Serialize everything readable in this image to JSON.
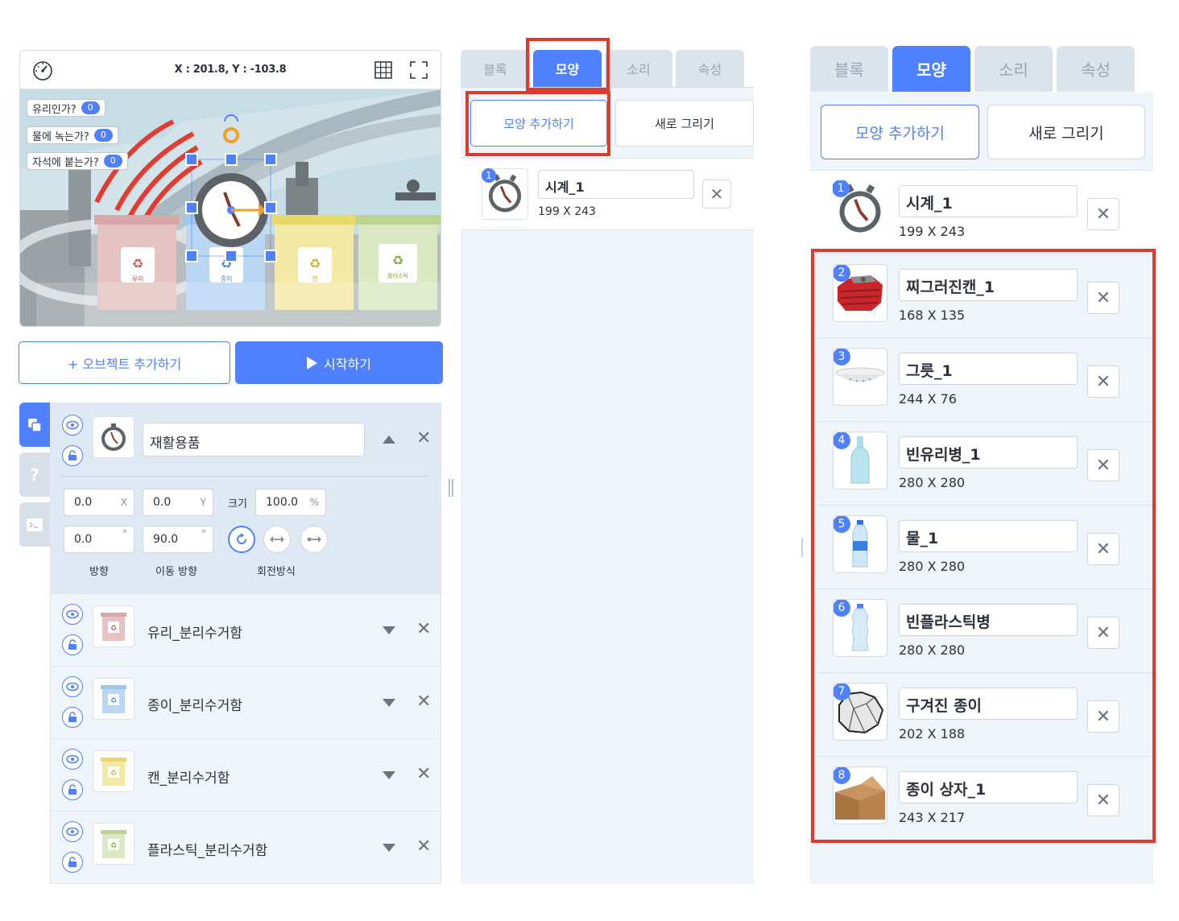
{
  "stage": {
    "coords": "X : 201.8, Y : -103.8",
    "variables": [
      {
        "label": "유리인가?",
        "value": "0"
      },
      {
        "label": "물에 녹는가?",
        "value": "0"
      },
      {
        "label": "자석에 붙는가?",
        "value": "0"
      }
    ],
    "bins": [
      "유리",
      "종이",
      "캔",
      "플라스틱"
    ]
  },
  "buttons": {
    "add_object": "+ 오브젝트 추가하기",
    "start": "시작하기"
  },
  "side_tabs": {
    "help": "?"
  },
  "selected_object": {
    "name": "재활용품",
    "x": "0.0",
    "x_unit": "X",
    "y": "0.0",
    "y_unit": "Y",
    "size_label": "크기",
    "size": "100.0",
    "size_unit": "%",
    "direction": "0.0",
    "direction_unit": "°",
    "move_direction": "90.0",
    "move_direction_unit": "°",
    "label_direction": "방향",
    "label_move_direction": "이동 방향",
    "label_rotation": "회전방식"
  },
  "objects": [
    {
      "name": "유리_분리수거함",
      "color": "#e8a7a7"
    },
    {
      "name": "종이_분리수거함",
      "color": "#9ec6ee"
    },
    {
      "name": "캔_분리수거함",
      "color": "#f1e28b"
    },
    {
      "name": "플라스틱_분리수거함",
      "color": "#c9dfa2"
    }
  ],
  "middle": {
    "tabs": [
      "블록",
      "모양",
      "소리",
      "속성"
    ],
    "add_shape": "모양 추가하기",
    "new_draw": "새로 그리기",
    "shape": {
      "num": "1",
      "name": "시계_1",
      "size": "199 X 243"
    }
  },
  "right": {
    "tabs": [
      "블록",
      "모양",
      "소리",
      "속성"
    ],
    "add_shape": "모양 추가하기",
    "new_draw": "새로 그리기",
    "shapes": [
      {
        "num": "1",
        "name": "시계_1",
        "size": "199 X 243",
        "icon": "clock-icon"
      },
      {
        "num": "2",
        "name": "찌그러진캔_1",
        "size": "168 X 135",
        "icon": "crushed-can-icon"
      },
      {
        "num": "3",
        "name": "그릇_1",
        "size": "244 X 76",
        "icon": "bowl-icon"
      },
      {
        "num": "4",
        "name": "빈유리병_1",
        "size": "280 X 280",
        "icon": "glass-bottle-icon"
      },
      {
        "num": "5",
        "name": "물_1",
        "size": "280 X 280",
        "icon": "water-bottle-icon"
      },
      {
        "num": "6",
        "name": "빈플라스틱병",
        "size": "280 X 280",
        "icon": "plastic-bottle-icon"
      },
      {
        "num": "7",
        "name": "구겨진 종이",
        "size": "202 X 188",
        "icon": "crumpled-paper-icon"
      },
      {
        "num": "8",
        "name": "종이 상자_1",
        "size": "243 X 217",
        "icon": "paper-box-icon"
      }
    ]
  },
  "colors": {
    "accent": "#4f80ff",
    "highlight": "#e03a2e",
    "panel": "#eef4fa"
  }
}
